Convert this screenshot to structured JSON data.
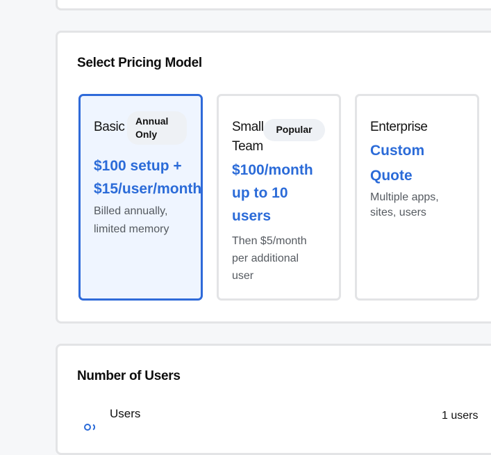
{
  "pricing": {
    "title": "Select Pricing Model",
    "plans": [
      {
        "name": "Basic",
        "badge": "Annual Only",
        "price": "$100 setup + $15/user/month",
        "description": "Billed annually, limited memory",
        "selected": true
      },
      {
        "name": "Small Team",
        "badge": "Popular",
        "price": "$100/month up to 10 users",
        "description": "Then $5/month per additional user",
        "selected": false
      },
      {
        "name": "Enterprise",
        "badge": "",
        "price": "Custom Quote",
        "description": "Multiple apps, sites, users",
        "selected": false
      }
    ]
  },
  "users_section": {
    "title": "Number of Users",
    "label": "Users",
    "count_text": "1 users",
    "icon": "users-icon"
  },
  "colors": {
    "accent": "#2b6bd8",
    "selected_border": "#2f6ad9",
    "selected_bg": "#eff5ff",
    "badge_bg": "#eef1f5",
    "card_border": "#e3e4e6"
  }
}
